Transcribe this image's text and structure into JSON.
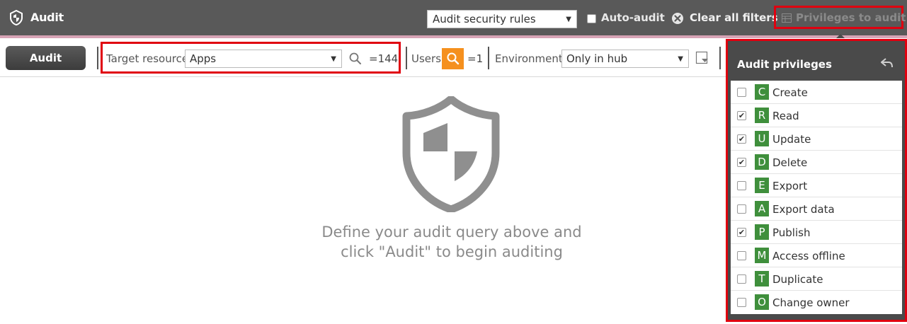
{
  "header": {
    "title": "Audit",
    "rules_select": "Audit security rules",
    "auto_audit_label": "Auto-audit",
    "clear_filters_label": "Clear all filters",
    "privileges_label": "Privileges to audit"
  },
  "toolbar": {
    "audit_button": "Audit",
    "target_label": "Target resource",
    "target_value": "Apps",
    "target_count": "=144",
    "users_label": "Users",
    "users_count": "=1",
    "environment_label": "Environment",
    "environment_value": "Only in hub"
  },
  "empty_state": {
    "line1": "Define your audit query above and",
    "line2": "click \"Audit\" to begin auditing"
  },
  "privileges_panel": {
    "title": "Audit privileges",
    "items": [
      {
        "letter": "C",
        "label": "Create",
        "checked": false
      },
      {
        "letter": "R",
        "label": "Read",
        "checked": true
      },
      {
        "letter": "U",
        "label": "Update",
        "checked": true
      },
      {
        "letter": "D",
        "label": "Delete",
        "checked": true
      },
      {
        "letter": "E",
        "label": "Export",
        "checked": false
      },
      {
        "letter": "A",
        "label": "Export data",
        "checked": false
      },
      {
        "letter": "P",
        "label": "Publish",
        "checked": true
      },
      {
        "letter": "M",
        "label": "Access offline",
        "checked": false
      },
      {
        "letter": "T",
        "label": "Duplicate",
        "checked": false
      },
      {
        "letter": "O",
        "label": "Change owner",
        "checked": false
      }
    ]
  },
  "colors": {
    "header_bg": "#595959",
    "accent_strip": "#d6a3b5",
    "highlight_border": "#e0000f",
    "users_search_bg": "#f5901e",
    "privilege_badge": "#3f8f3c"
  },
  "icons": {
    "app": "shield-icon",
    "clear": "close-circle-icon",
    "privileges": "table-icon",
    "target_search": "search-icon",
    "users_search": "search-icon",
    "env_filter": "filter-icon",
    "panel_back": "back-arrow-icon",
    "empty_state": "shield-icon"
  }
}
